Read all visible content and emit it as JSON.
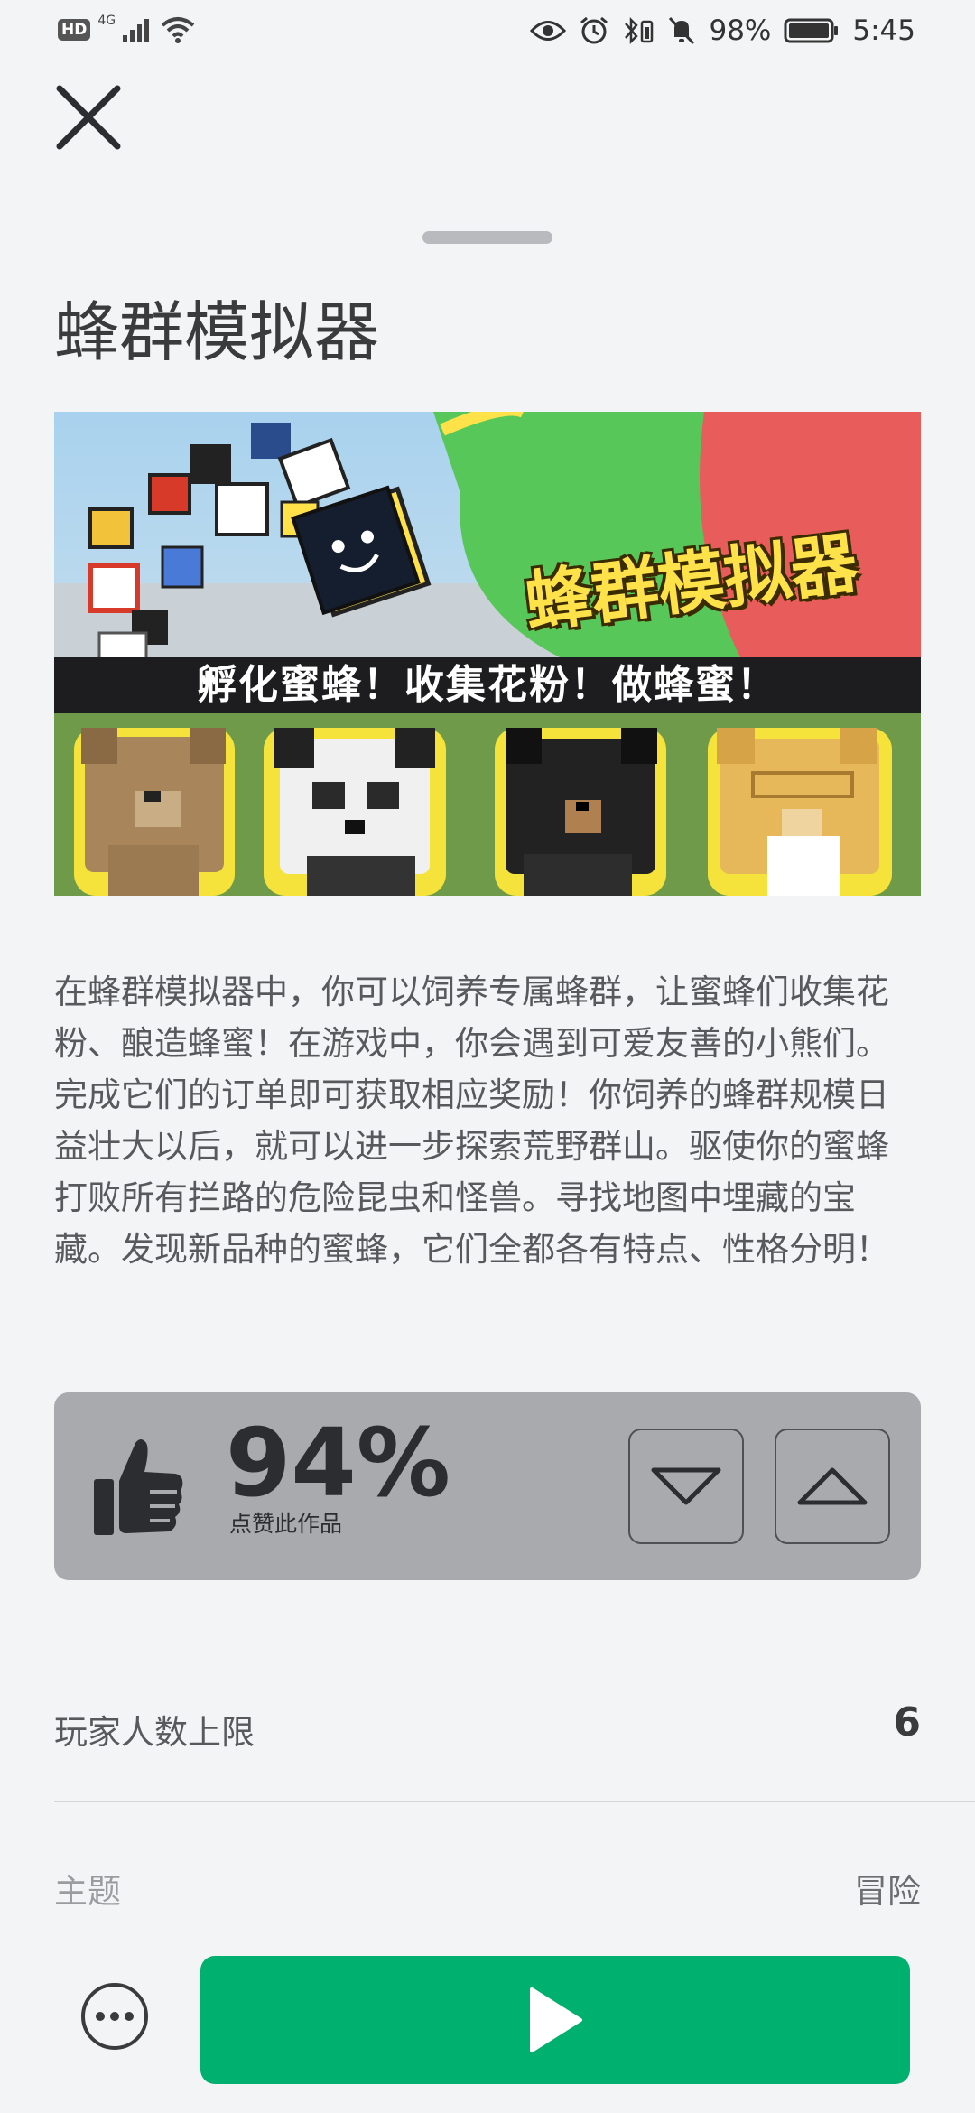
{
  "status_bar": {
    "hd": "HD",
    "network": "4G",
    "battery_pct": "98%",
    "time": "5:45"
  },
  "game": {
    "title": "蜂群模拟器",
    "banner": {
      "logo_text": "蜂群模拟器",
      "strip_text": "孵化蜜蜂！收集花粉！做蜂蜜！"
    },
    "description": "在蜂群模拟器中，你可以饲养专属蜂群，让蜜蜂们收集花粉、酿造蜂蜜！在游戏中，你会遇到可爱友善的小熊们。完成它们的订单即可获取相应奖励！你饲养的蜂群规模日益壮大以后，就可以进一步探索荒野群山。驱使你的蜜蜂打败所有拦路的危险昆虫和怪兽。寻找地图中埋藏的宝藏。发现新品种的蜜蜂，它们全都各有特点、性格分明！"
  },
  "rating": {
    "percent": "94%",
    "label": "点赞此作品"
  },
  "details": {
    "max_players_label": "玩家人数上限",
    "max_players_value": "6",
    "genre_label": "主题",
    "genre_value": "冒险"
  },
  "icons": {
    "close": "close-icon",
    "thumbs_up": "thumbs-up-icon",
    "vote_down": "chevron-down-icon",
    "vote_up": "chevron-up-icon",
    "more": "more-icon",
    "play": "play-icon"
  },
  "colors": {
    "play_button": "#00b06f",
    "rating_card": "#a8aaad",
    "background": "#f2f4f5"
  }
}
